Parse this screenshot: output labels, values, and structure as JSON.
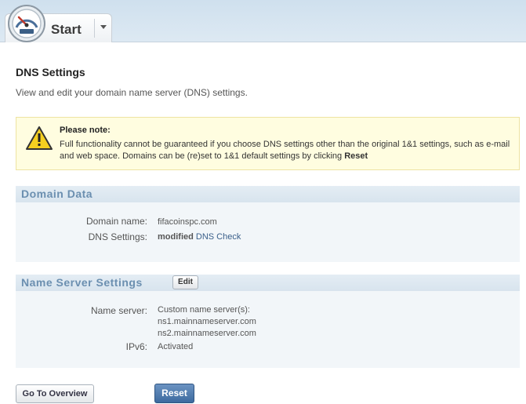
{
  "tab": {
    "label": "Start"
  },
  "header": {
    "title": "DNS Settings",
    "subtitle": "View and edit your domain name server (DNS) settings."
  },
  "note": {
    "title": "Please note:",
    "text_part1": "Full functionality cannot be guaranteed if you choose DNS settings other than the original 1&1 settings, such as e-mail and web space. Domains can be (re)set to 1&1 default settings by clicking ",
    "text_bold": "Reset"
  },
  "domain_data": {
    "title": "Domain Data",
    "domain_name_label": "Domain name:",
    "domain_name_value": "fifacoinspc.com",
    "dns_settings_label": "DNS Settings:",
    "dns_settings_value": "modified",
    "dns_check_link": "DNS Check"
  },
  "name_server_settings": {
    "title": "Name Server Settings",
    "edit_label": "Edit",
    "name_server_label": "Name server:",
    "name_server_type": "Custom name server(s):",
    "name_servers": [
      "ns1.mainnameserver.com",
      "ns2.mainnameserver.com"
    ],
    "ipv6_label": "IPv6:",
    "ipv6_value": "Activated"
  },
  "actions": {
    "overview_label": "Go To Overview",
    "reset_label": "Reset"
  },
  "colors": {
    "section_title": "#6b8fb0",
    "primary_button": "#3d6a9f",
    "note_background": "#fffde0"
  }
}
